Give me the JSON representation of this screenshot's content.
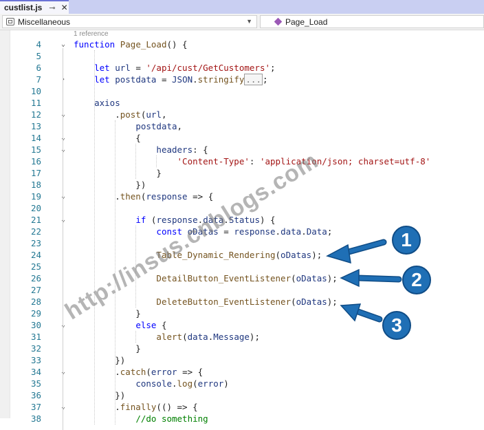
{
  "tab": {
    "title": "custlist.js",
    "pin": "⊸",
    "close": "✕"
  },
  "navbar": {
    "project": "Miscellaneous",
    "member": "Page_Load"
  },
  "codelens": "1 reference",
  "lines": [
    {
      "n": "4",
      "fold": "⌄",
      "html": "<span class='kw'>function</span> <span class='fn'>Page_Load</span>() {"
    },
    {
      "n": "5",
      "fold": "",
      "html": ""
    },
    {
      "n": "6",
      "fold": "",
      "html": "    <span class='kw'>let</span> <span class='prop'>url</span> = <span class='str'>'/api/cust/GetCustomers'</span>;"
    },
    {
      "n": "7",
      "fold": "›",
      "html": "    <span class='kw'>let</span> <span class='prop'>postdata</span> = <span class='prop'>JSON</span>.<span class='fn'>stringify</span><span class='collapsed'>...</span>;"
    },
    {
      "n": "10",
      "fold": "",
      "html": ""
    },
    {
      "n": "11",
      "fold": "",
      "html": "    <span class='prop'>axios</span>"
    },
    {
      "n": "12",
      "fold": "⌄",
      "html": "        .<span class='fn'>post</span>(<span class='prop'>url</span>,"
    },
    {
      "n": "13",
      "fold": "",
      "html": "            <span class='prop'>postdata</span>,"
    },
    {
      "n": "14",
      "fold": "⌄",
      "html": "            {"
    },
    {
      "n": "15",
      "fold": "⌄",
      "html": "                <span class='prop'>headers</span>: {"
    },
    {
      "n": "16",
      "fold": "",
      "html": "                    <span class='str'>'Content-Type'</span>: <span class='str'>'application/json; charset=utf-8'</span>"
    },
    {
      "n": "17",
      "fold": "",
      "html": "                }"
    },
    {
      "n": "18",
      "fold": "",
      "html": "            })"
    },
    {
      "n": "19",
      "fold": "⌄",
      "html": "        .<span class='fn'>then</span>(<span class='prop'>response</span> =&gt; {"
    },
    {
      "n": "20",
      "fold": "",
      "html": ""
    },
    {
      "n": "21",
      "fold": "⌄",
      "html": "            <span class='kw'>if</span> (<span class='prop'>response</span>.<span class='prop'>data</span>.<span class='prop'>Status</span>) {"
    },
    {
      "n": "22",
      "fold": "",
      "html": "                <span class='kw'>const</span> <span class='prop'>oDatas</span> = <span class='prop'>response</span>.<span class='prop'>data</span>.<span class='prop'>Data</span>;"
    },
    {
      "n": "23",
      "fold": "",
      "html": ""
    },
    {
      "n": "24",
      "fold": "",
      "html": "                <span class='fn'>Table_Dynamic_Rendering</span>(<span class='prop'>oDatas</span>);"
    },
    {
      "n": "25",
      "fold": "",
      "html": ""
    },
    {
      "n": "26",
      "fold": "",
      "html": "                <span class='fn'>DetailButton_EventListener</span>(<span class='prop'>oDatas</span>);"
    },
    {
      "n": "27",
      "fold": "",
      "html": ""
    },
    {
      "n": "28",
      "fold": "",
      "html": "                <span class='fn'>DeleteButton_EventListener</span>(<span class='prop'>oDatas</span>);"
    },
    {
      "n": "29",
      "fold": "",
      "html": "            }"
    },
    {
      "n": "30",
      "fold": "⌄",
      "html": "            <span class='kw'>else</span> {"
    },
    {
      "n": "31",
      "fold": "",
      "html": "                <span class='fn'>alert</span>(<span class='prop'>data</span>.<span class='prop'>Message</span>);"
    },
    {
      "n": "32",
      "fold": "",
      "html": "            }"
    },
    {
      "n": "33",
      "fold": "",
      "html": "        })"
    },
    {
      "n": "34",
      "fold": "⌄",
      "html": "        .<span class='fn'>catch</span>(<span class='prop'>error</span> =&gt; {"
    },
    {
      "n": "35",
      "fold": "",
      "html": "            <span class='prop'>console</span>.<span class='fn'>log</span>(<span class='prop'>error</span>)"
    },
    {
      "n": "36",
      "fold": "",
      "html": "        })"
    },
    {
      "n": "37",
      "fold": "⌄",
      "html": "        .<span class='fn'>finally</span>(() =&gt; {"
    },
    {
      "n": "38",
      "fold": "",
      "html": "            <span style='color:#008000'>//do something</span>"
    }
  ],
  "watermark": "http://insus.cnblogs.com",
  "callouts": [
    {
      "label": "1"
    },
    {
      "label": "2"
    },
    {
      "label": "3"
    }
  ],
  "colors": {
    "keyword": "#0000ff",
    "string": "#a31515",
    "function": "#74531f",
    "identifier": "#1f377f",
    "line_number": "#237893",
    "callout": "#1f6fb5"
  }
}
